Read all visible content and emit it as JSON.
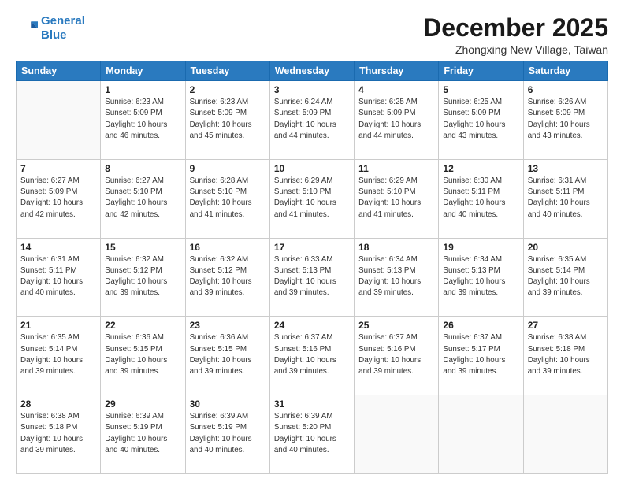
{
  "logo": {
    "line1": "General",
    "line2": "Blue"
  },
  "title": "December 2025",
  "location": "Zhongxing New Village, Taiwan",
  "days_header": [
    "Sunday",
    "Monday",
    "Tuesday",
    "Wednesday",
    "Thursday",
    "Friday",
    "Saturday"
  ],
  "weeks": [
    [
      {
        "day": "",
        "info": ""
      },
      {
        "day": "1",
        "info": "Sunrise: 6:23 AM\nSunset: 5:09 PM\nDaylight: 10 hours\nand 46 minutes."
      },
      {
        "day": "2",
        "info": "Sunrise: 6:23 AM\nSunset: 5:09 PM\nDaylight: 10 hours\nand 45 minutes."
      },
      {
        "day": "3",
        "info": "Sunrise: 6:24 AM\nSunset: 5:09 PM\nDaylight: 10 hours\nand 44 minutes."
      },
      {
        "day": "4",
        "info": "Sunrise: 6:25 AM\nSunset: 5:09 PM\nDaylight: 10 hours\nand 44 minutes."
      },
      {
        "day": "5",
        "info": "Sunrise: 6:25 AM\nSunset: 5:09 PM\nDaylight: 10 hours\nand 43 minutes."
      },
      {
        "day": "6",
        "info": "Sunrise: 6:26 AM\nSunset: 5:09 PM\nDaylight: 10 hours\nand 43 minutes."
      }
    ],
    [
      {
        "day": "7",
        "info": "Sunrise: 6:27 AM\nSunset: 5:09 PM\nDaylight: 10 hours\nand 42 minutes."
      },
      {
        "day": "8",
        "info": "Sunrise: 6:27 AM\nSunset: 5:10 PM\nDaylight: 10 hours\nand 42 minutes."
      },
      {
        "day": "9",
        "info": "Sunrise: 6:28 AM\nSunset: 5:10 PM\nDaylight: 10 hours\nand 41 minutes."
      },
      {
        "day": "10",
        "info": "Sunrise: 6:29 AM\nSunset: 5:10 PM\nDaylight: 10 hours\nand 41 minutes."
      },
      {
        "day": "11",
        "info": "Sunrise: 6:29 AM\nSunset: 5:10 PM\nDaylight: 10 hours\nand 41 minutes."
      },
      {
        "day": "12",
        "info": "Sunrise: 6:30 AM\nSunset: 5:11 PM\nDaylight: 10 hours\nand 40 minutes."
      },
      {
        "day": "13",
        "info": "Sunrise: 6:31 AM\nSunset: 5:11 PM\nDaylight: 10 hours\nand 40 minutes."
      }
    ],
    [
      {
        "day": "14",
        "info": "Sunrise: 6:31 AM\nSunset: 5:11 PM\nDaylight: 10 hours\nand 40 minutes."
      },
      {
        "day": "15",
        "info": "Sunrise: 6:32 AM\nSunset: 5:12 PM\nDaylight: 10 hours\nand 39 minutes."
      },
      {
        "day": "16",
        "info": "Sunrise: 6:32 AM\nSunset: 5:12 PM\nDaylight: 10 hours\nand 39 minutes."
      },
      {
        "day": "17",
        "info": "Sunrise: 6:33 AM\nSunset: 5:13 PM\nDaylight: 10 hours\nand 39 minutes."
      },
      {
        "day": "18",
        "info": "Sunrise: 6:34 AM\nSunset: 5:13 PM\nDaylight: 10 hours\nand 39 minutes."
      },
      {
        "day": "19",
        "info": "Sunrise: 6:34 AM\nSunset: 5:13 PM\nDaylight: 10 hours\nand 39 minutes."
      },
      {
        "day": "20",
        "info": "Sunrise: 6:35 AM\nSunset: 5:14 PM\nDaylight: 10 hours\nand 39 minutes."
      }
    ],
    [
      {
        "day": "21",
        "info": "Sunrise: 6:35 AM\nSunset: 5:14 PM\nDaylight: 10 hours\nand 39 minutes."
      },
      {
        "day": "22",
        "info": "Sunrise: 6:36 AM\nSunset: 5:15 PM\nDaylight: 10 hours\nand 39 minutes."
      },
      {
        "day": "23",
        "info": "Sunrise: 6:36 AM\nSunset: 5:15 PM\nDaylight: 10 hours\nand 39 minutes."
      },
      {
        "day": "24",
        "info": "Sunrise: 6:37 AM\nSunset: 5:16 PM\nDaylight: 10 hours\nand 39 minutes."
      },
      {
        "day": "25",
        "info": "Sunrise: 6:37 AM\nSunset: 5:16 PM\nDaylight: 10 hours\nand 39 minutes."
      },
      {
        "day": "26",
        "info": "Sunrise: 6:37 AM\nSunset: 5:17 PM\nDaylight: 10 hours\nand 39 minutes."
      },
      {
        "day": "27",
        "info": "Sunrise: 6:38 AM\nSunset: 5:18 PM\nDaylight: 10 hours\nand 39 minutes."
      }
    ],
    [
      {
        "day": "28",
        "info": "Sunrise: 6:38 AM\nSunset: 5:18 PM\nDaylight: 10 hours\nand 39 minutes."
      },
      {
        "day": "29",
        "info": "Sunrise: 6:39 AM\nSunset: 5:19 PM\nDaylight: 10 hours\nand 40 minutes."
      },
      {
        "day": "30",
        "info": "Sunrise: 6:39 AM\nSunset: 5:19 PM\nDaylight: 10 hours\nand 40 minutes."
      },
      {
        "day": "31",
        "info": "Sunrise: 6:39 AM\nSunset: 5:20 PM\nDaylight: 10 hours\nand 40 minutes."
      },
      {
        "day": "",
        "info": ""
      },
      {
        "day": "",
        "info": ""
      },
      {
        "day": "",
        "info": ""
      }
    ]
  ]
}
